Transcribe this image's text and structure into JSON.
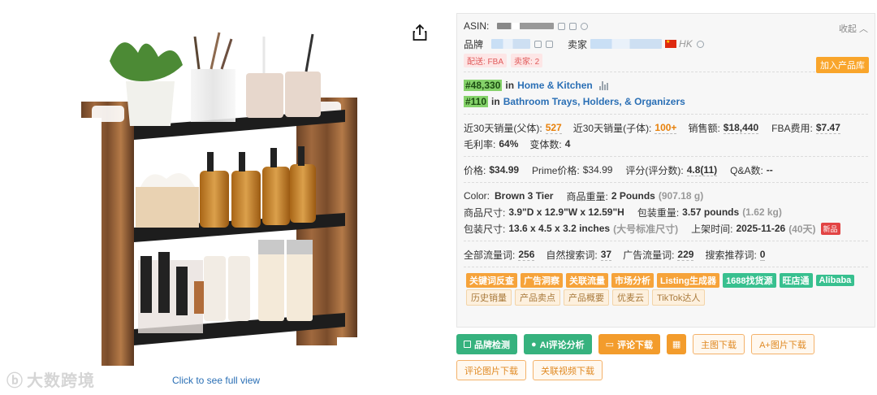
{
  "image_area": {
    "full_view_link": "Click to see full view",
    "watermark": "大数跨境",
    "share_icon": "share-icon"
  },
  "panel": {
    "asin_label": "ASIN:",
    "collapse_label": "收起",
    "brand_label": "品牌",
    "seller_label": "卖家",
    "seller_location": "HK",
    "delivery_tag": "配送: FBA",
    "seller_count_tag": "卖家: 2",
    "add_button": "加入产品库",
    "ranks": [
      {
        "rank": "#48,330",
        "in": "in",
        "category": "Home & Kitchen"
      },
      {
        "rank": "#110",
        "in": "in",
        "category": "Bathroom Trays, Holders, & Organizers"
      }
    ],
    "stats": {
      "sales30_parent_label": "近30天销量(父体):",
      "sales30_parent": "527",
      "sales30_child_label": "近30天销量(子体):",
      "sales30_child": "100+",
      "revenue_label": "销售额:",
      "revenue": "$18,440",
      "fba_fee_label": "FBA费用:",
      "fba_fee": "$7.47",
      "margin_label": "毛利率:",
      "margin": "64%",
      "variants_label": "变体数:",
      "variants": "4"
    },
    "price": {
      "price_label": "价格:",
      "price": "$34.99",
      "prime_label": "Prime价格:",
      "prime_price": "$34.99",
      "rating_label": "评分(评分数):",
      "rating": "4.8(11)",
      "qa_label": "Q&A数:",
      "qa": "--"
    },
    "details": {
      "color_label": "Color:",
      "color": "Brown 3 Tier",
      "weight_label": "商品重量:",
      "weight": "2 Pounds",
      "weight_g": "(907.18 g)",
      "size_label": "商品尺寸:",
      "size": "3.9\"D x 12.9\"W x 12.59\"H",
      "pkg_weight_label": "包装重量:",
      "pkg_weight": "3.57 pounds",
      "pkg_weight_kg": "(1.62 kg)",
      "pkg_size_label": "包装尺寸:",
      "pkg_size": "13.6 x 4.5 x 3.2 inches",
      "pkg_size_note": "(大号标准尺寸)",
      "listed_label": "上架时间:",
      "listed": "2025-11-26",
      "listed_days": "(40天)",
      "new_badge": "新品"
    },
    "traffic": {
      "all_label": "全部流量词:",
      "all": "256",
      "organic_label": "自然搜索词:",
      "organic": "37",
      "ad_label": "广告流量词:",
      "ad": "229",
      "recommend_label": "搜索推荐词:",
      "recommend": "0"
    },
    "tools_row1": [
      {
        "label": "关键词反查",
        "style": "orange"
      },
      {
        "label": "广告洞察",
        "style": "orange"
      },
      {
        "label": "关联流量",
        "style": "orange"
      },
      {
        "label": "市场分析",
        "style": "orange"
      },
      {
        "label": "Listing生成器",
        "style": "orange"
      },
      {
        "label": "1688找货源",
        "style": "green"
      },
      {
        "label": "旺店通",
        "style": "green"
      },
      {
        "label": "Alibaba",
        "style": "green"
      }
    ],
    "tools_row2": [
      "历史销量",
      "产品卖点",
      "产品概要",
      "优麦云",
      "TikTok达人"
    ]
  },
  "buttons_row1": {
    "brand_check": "品牌检测",
    "ai_review": "AI评论分析",
    "review_download": "评论下载",
    "main_image_download": "主图下载",
    "aplus_download": "A+图片下载"
  },
  "buttons_row2": {
    "review_image_download": "评论图片下载",
    "related_video_download": "关联视频下载"
  },
  "colors": {
    "accent_orange": "#f39c2c",
    "accent_green": "#36b27e",
    "link_blue": "#2a6fb5",
    "rank_green": "#85d26a"
  }
}
